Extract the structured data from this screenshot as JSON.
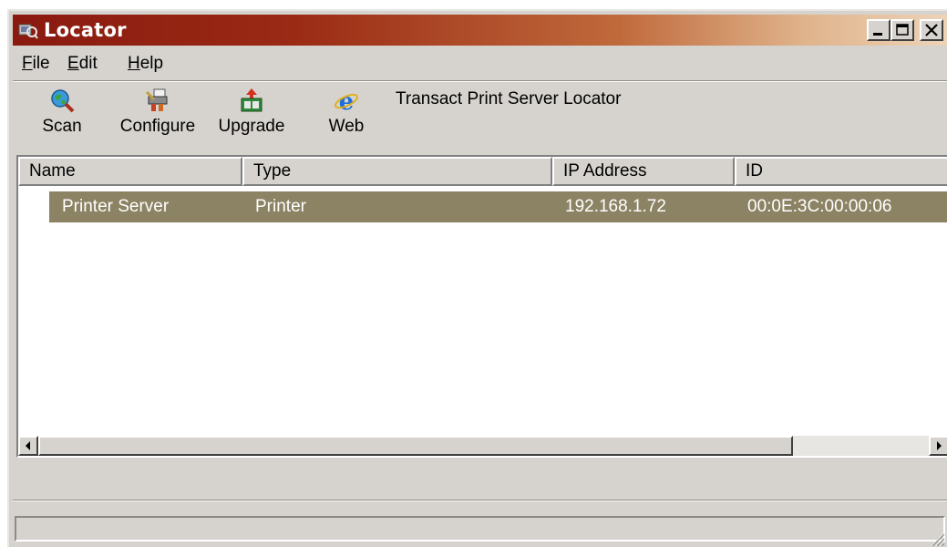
{
  "window": {
    "title": "Locator",
    "icon": "locator-app-icon",
    "controls": {
      "minimize": "minimize-icon",
      "maximize": "maximize-icon",
      "close": "close-icon"
    }
  },
  "menu": {
    "file": {
      "accel": "F",
      "rest": "ile"
    },
    "edit": {
      "accel": "E",
      "rest": "dit"
    },
    "help": {
      "accel": "H",
      "rest": "elp"
    }
  },
  "toolbar": {
    "scan_label": "Scan",
    "configure_label": "Configure",
    "upgrade_label": "Upgrade",
    "web_label": "Web",
    "title": "Transact Print Server Locator"
  },
  "table": {
    "columns": [
      "Name",
      "Type",
      "IP Address",
      "ID"
    ],
    "rows": [
      {
        "name": "Printer Server",
        "type": "Printer",
        "ip": "192.168.1.72",
        "id": "00:0E:3C:00:00:06",
        "selected": true
      }
    ]
  },
  "status": {
    "text": ""
  },
  "colors": {
    "title_start": "#8a1a10",
    "title_end": "#ecd3b8",
    "selection": "#8c8364",
    "face": "#d6d3ce"
  }
}
